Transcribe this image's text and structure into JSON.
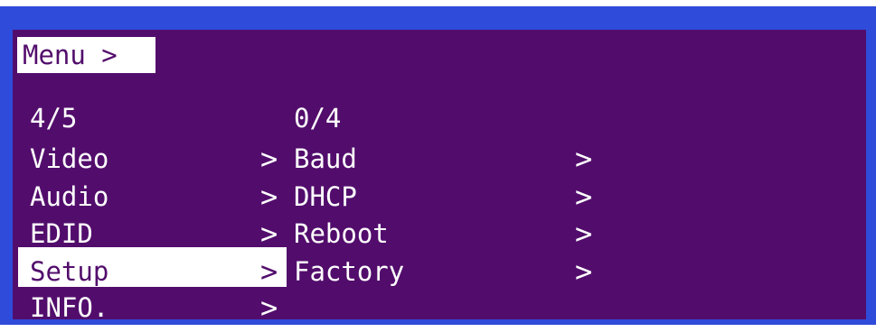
{
  "header": {
    "breadcrumb": "Menu >"
  },
  "left_menu": {
    "counter": "4/5",
    "selected_index": 3,
    "items": [
      {
        "label": "Video",
        "arrow": ">"
      },
      {
        "label": "Audio",
        "arrow": ">"
      },
      {
        "label": "EDID",
        "arrow": ">"
      },
      {
        "label": "Setup",
        "arrow": ">"
      },
      {
        "label": "INFO.",
        "arrow": ">"
      }
    ]
  },
  "sub_menu": {
    "counter": "0/4",
    "items": [
      {
        "label": "Baud",
        "arrow": ">"
      },
      {
        "label": "DHCP",
        "arrow": ">"
      },
      {
        "label": "Reboot",
        "arrow": ">"
      },
      {
        "label": "Factory",
        "arrow": ">"
      }
    ]
  },
  "colors": {
    "bezel": "#2f4bd9",
    "background": "#520d6c",
    "text": "#ffffff",
    "highlight": "#ffffff"
  }
}
